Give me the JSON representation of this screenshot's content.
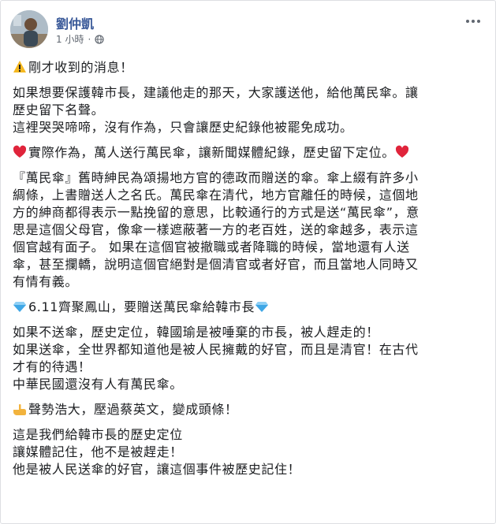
{
  "post": {
    "author": "劉仲凱",
    "timestamp": "1 小時",
    "privacy_icon": "globe-icon",
    "more_icon": "more-horizontal-icon"
  },
  "paragraphs": {
    "p1": {
      "icon": "warning-icon",
      "text": "剛才收到的消息！"
    },
    "p2": {
      "lines": [
        "如果想要保護韓市長，建議他走的那天，大家護送他，給他萬民傘。讓",
        "歷史留下名聲。",
        "這裡哭哭啼啼，沒有作為，只會讓歷史紀錄他被罷免成功。"
      ]
    },
    "p3": {
      "icon_left": "red-heart-icon",
      "text": "實際作為，萬人送行萬民傘，讓新聞媒體紀錄，歷史留下定位。",
      "icon_right": "red-heart-icon"
    },
    "p4": {
      "lines": [
        "『萬民傘』舊時紳民為頌揚地方官的德政而贈送的傘。傘上綴有許多小",
        "綢條，上書贈送人之名氏。萬民傘在清代，地方官離任的時候，這個地",
        "方的紳商都得表示一點挽留的意思，比較通行的方式是送“萬民傘”，意",
        "思是這個父母官，像傘一樣遮蔽著一方的老百姓，送的傘越多，表示這",
        "個官越有面子。 如果在這個官被撤職或者降職的時候，當地還有人送",
        "傘，甚至攔轎，說明這個官絕對是個清官或者好官，而且當地人同時又",
        "有情有義。"
      ]
    },
    "p5": {
      "icon_left": "diamond-icon",
      "text": "6.11齊聚鳳山，要贈送萬民傘給韓市長",
      "icon_right": "diamond-icon"
    },
    "p6": {
      "lines": [
        "如果不送傘，歷史定位，韓國瑜是被唾棄的市長，被人趕走的！",
        "如果送傘，全世界都知道他是被人民擁戴的好官，而且是清官！在古代",
        "才有的待遇！",
        "中華民國還沒有人有萬民傘。"
      ]
    },
    "p7": {
      "icon": "pointing-hand-icon",
      "text": "聲勢浩大，壓過蔡英文，變成頭條！"
    },
    "p8": {
      "lines": [
        "這是我們給韓市長的歷史定位",
        "讓媒體記住，他不是被趕走！",
        "他是被人民送傘的好官，讓這個事件被歷史記住！"
      ]
    }
  },
  "colors": {
    "author": "#385898",
    "text": "#1c1e21",
    "meta": "#606770",
    "heart": "#e0243b",
    "diamond": "#3fa7e6",
    "warning": "#f5b820"
  }
}
